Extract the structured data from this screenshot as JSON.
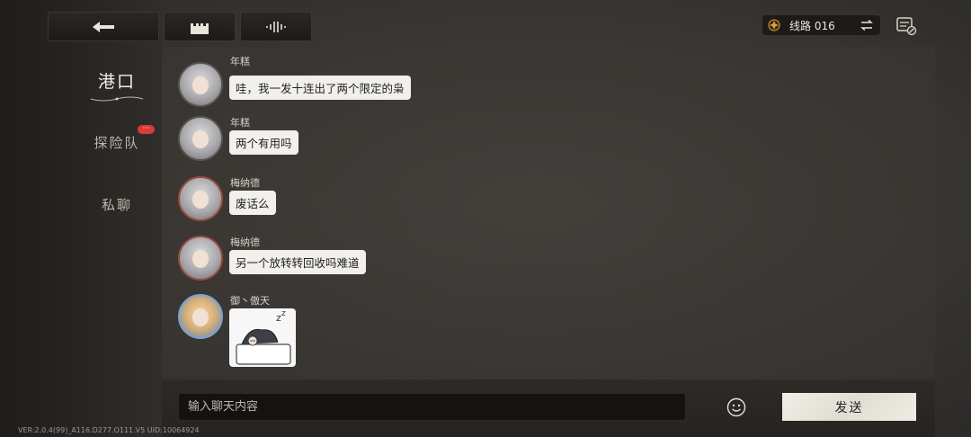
{
  "sidebar": {
    "items": [
      {
        "label": "港口",
        "active": true
      },
      {
        "label": "探险队",
        "badge": "···"
      },
      {
        "label": "私聊"
      }
    ]
  },
  "topbar": {
    "back_icon": "back-arrow-icon",
    "castle_icon": "castle-icon",
    "voice_icon": "soundwave-icon",
    "route_label": "线路 016",
    "route_icon": "gem-icon",
    "swap_icon": "swap-icon",
    "settings_icon": "chat-settings-icon"
  },
  "messages": [
    {
      "name": "年糕",
      "text": "哇，我一发十连出了两个限定的枭",
      "avatar": "silver-hair"
    },
    {
      "name": "年糕",
      "text": "两个有用吗",
      "avatar": "silver-hair"
    },
    {
      "name": "梅纳德",
      "text": "废话么",
      "avatar": "silver-hair-red"
    },
    {
      "name": "梅纳德",
      "text": "另一个放转转回收吗难道",
      "avatar": "silver-hair-red"
    },
    {
      "name": "御丶傲天",
      "sticker": "sleeping-character-sticker",
      "avatar": "blonde-hair"
    }
  ],
  "input": {
    "placeholder": "输入聊天内容",
    "send_label": "发送",
    "emoji_icon": "smiley-icon"
  },
  "footer": {
    "version": "VER:2.0.4(99)_A116.D277.O111.V5   UID:10064924"
  },
  "colors": {
    "badge": "#d93a3a",
    "bubble": "#f2f0ec",
    "accent_gem": "#e0a23a"
  }
}
